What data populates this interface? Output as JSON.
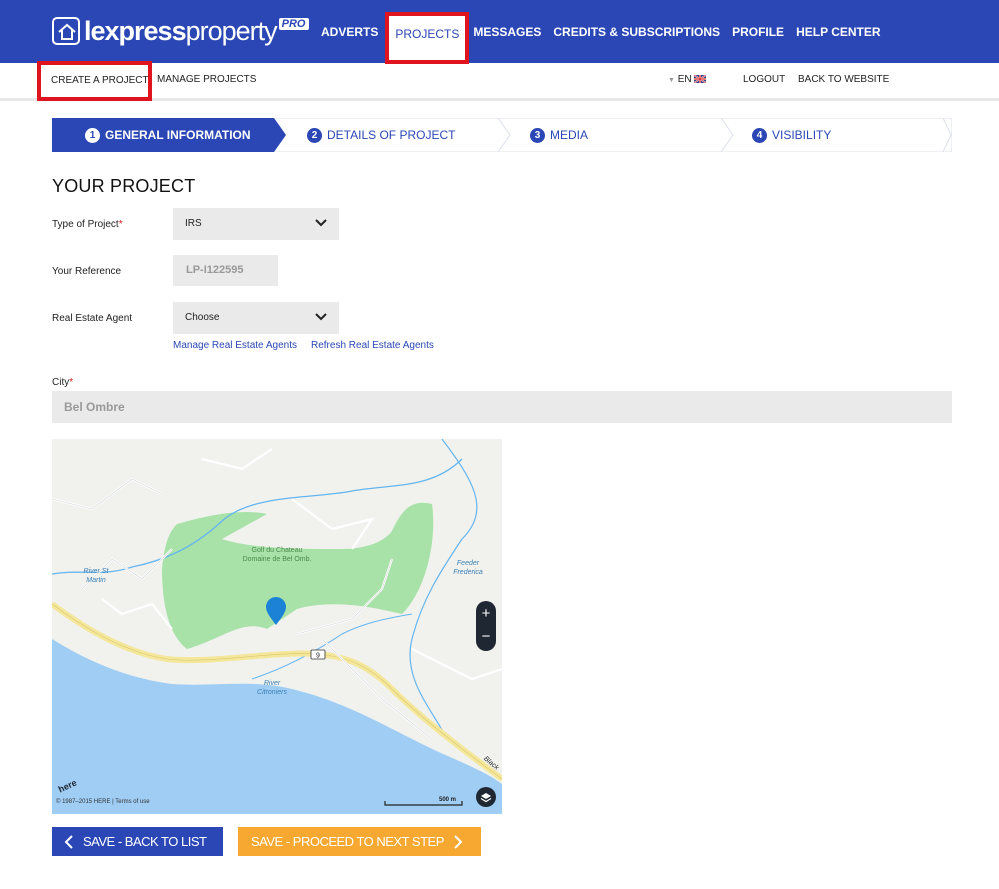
{
  "brand": {
    "name_bold": "lexpress",
    "name_light": "property",
    "badge": "PRO"
  },
  "nav": {
    "items": [
      {
        "label": "ADVERTS"
      },
      {
        "label": "PROJECTS"
      },
      {
        "label": "MESSAGES"
      },
      {
        "label": "CREDITS & SUBSCRIPTIONS"
      },
      {
        "label": "PROFILE"
      },
      {
        "label": "HELP CENTER"
      }
    ],
    "active": "PROJECTS"
  },
  "subnav": {
    "create": "CREATE A PROJECT",
    "manage": "MANAGE PROJECTS",
    "language": "EN",
    "logout": "LOGOUT",
    "back": "BACK TO WEBSITE"
  },
  "steps": [
    {
      "num": "1",
      "label": "GENERAL INFORMATION"
    },
    {
      "num": "2",
      "label": "DETAILS OF PROJECT"
    },
    {
      "num": "3",
      "label": "MEDIA"
    },
    {
      "num": "4",
      "label": "VISIBILITY"
    }
  ],
  "form": {
    "section_title": "YOUR PROJECT",
    "type_label": "Type of Project",
    "type_value": "IRS",
    "ref_label": "Your Reference",
    "ref_value": "LP-I122595",
    "agent_label": "Real Estate Agent",
    "agent_value": "Choose",
    "manage_agents": "Manage Real Estate Agents",
    "refresh_agents": "Refresh Real Estate Agents",
    "city_label": "City",
    "city_value": "Bel Ombre",
    "required_mark": "*"
  },
  "map": {
    "labels": {
      "golf": "Golf du Chateau Domaine de Bel Omb.",
      "river_st_martin": "River St Martin",
      "feeder": "Feeder Frederica",
      "river_citroniers": "River Citroniers",
      "black": "Black",
      "route": "9"
    },
    "zoom_in": "+",
    "zoom_out": "−",
    "copyright": "© 1987–2015 HERE | Terms of use",
    "scale": "500 m",
    "provider": "here"
  },
  "buttons": {
    "back": "SAVE - BACK TO LIST",
    "next": "SAVE - PROCEED TO NEXT STEP"
  },
  "colors": {
    "primary": "#2b47b5",
    "accent": "#f7a830",
    "highlight": "#e0141e"
  }
}
